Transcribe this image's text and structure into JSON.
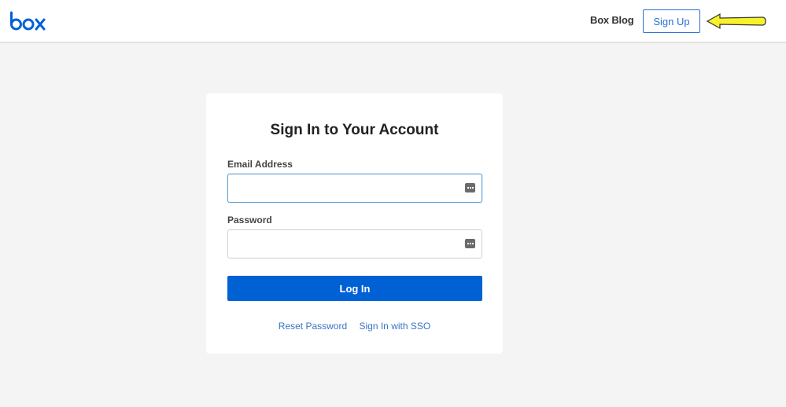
{
  "header": {
    "logo_text": "box",
    "blog_link": "Box Blog",
    "signup_label": "Sign Up",
    "brand_color": "#0061d5",
    "annotation_arrow_color": "#f7f22a"
  },
  "login": {
    "title": "Sign In to Your Account",
    "email_label": "Email Address",
    "email_value": "",
    "password_label": "Password",
    "password_value": "",
    "login_button": "Log In",
    "reset_password": "Reset Password",
    "sso_link": "Sign In with SSO",
    "icons": {
      "field_icon": "password-manager-icon"
    }
  }
}
